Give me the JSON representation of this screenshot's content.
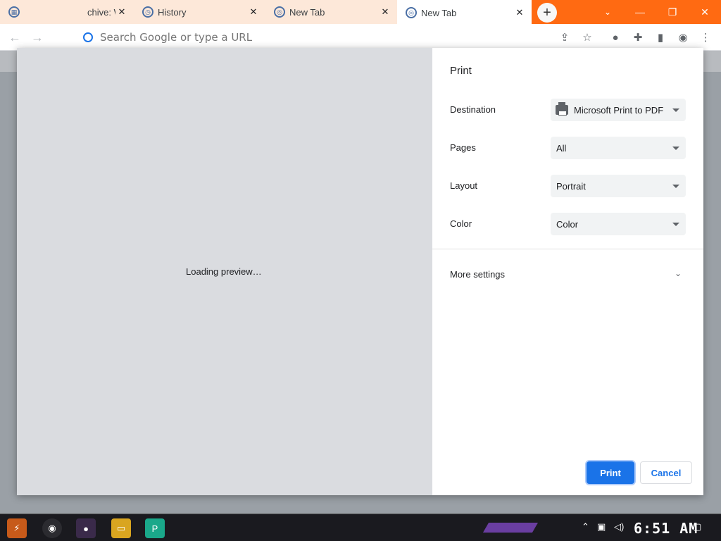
{
  "browser": {
    "tabs": [
      {
        "label": "chive: W",
        "active": false
      },
      {
        "label": "History",
        "active": false
      },
      {
        "label": "New Tab",
        "active": false
      },
      {
        "label": "New Tab",
        "active": true
      }
    ],
    "omnibox_placeholder": "Search Google or type a URL",
    "new_tab_symbol": "+",
    "window_controls": {
      "minimize": "—",
      "restore": "❐",
      "close": "✕"
    }
  },
  "print_dialog": {
    "preview_loading_text": "Loading preview…",
    "title": "Print",
    "settings": [
      {
        "label": "Destination",
        "value": "Microsoft Print to PDF",
        "icon": "printer-icon"
      },
      {
        "label": "Pages",
        "value": "All"
      },
      {
        "label": "Layout",
        "value": "Portrait"
      },
      {
        "label": "Color",
        "value": "Color"
      }
    ],
    "more_settings_label": "More settings",
    "print_button": "Print",
    "cancel_button": "Cancel"
  },
  "taskbar": {
    "clock": "6:51 AM"
  },
  "colors": {
    "tabstrip": "#ff6a12",
    "accent": "#1a73e8",
    "preview_bg": "#dadce0"
  }
}
